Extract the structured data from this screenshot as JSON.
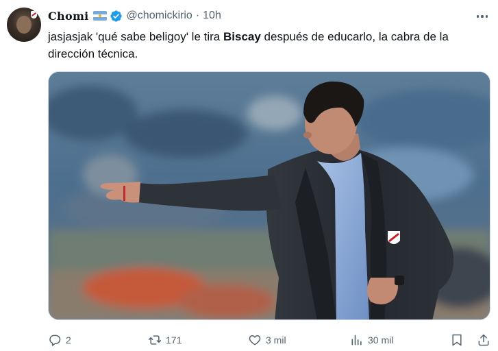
{
  "tweet": {
    "display_name": "Chomi",
    "handle": "@chomickirio",
    "separator": "·",
    "time": "10h",
    "text_before": "jasjasjak 'qué sabe beligoy' le tira ",
    "text_bold": "Biscay",
    "text_after": " después de educarlo, la cabra de la dirección técnica."
  },
  "icons": {
    "flag": "argentina-flag-icon",
    "verified": "verified-badge-icon",
    "more": "more-options-icon",
    "reply": "reply-icon",
    "retweet": "retweet-icon",
    "like": "like-icon",
    "views": "views-icon",
    "bookmark": "bookmark-icon",
    "share": "share-icon"
  },
  "colors": {
    "verified": "#1d9bf0",
    "muted_text": "#536471",
    "main_text": "#0f1419"
  },
  "actions": {
    "replies": "2",
    "retweets": "171",
    "likes": "3 mil",
    "views": "30 mil"
  }
}
